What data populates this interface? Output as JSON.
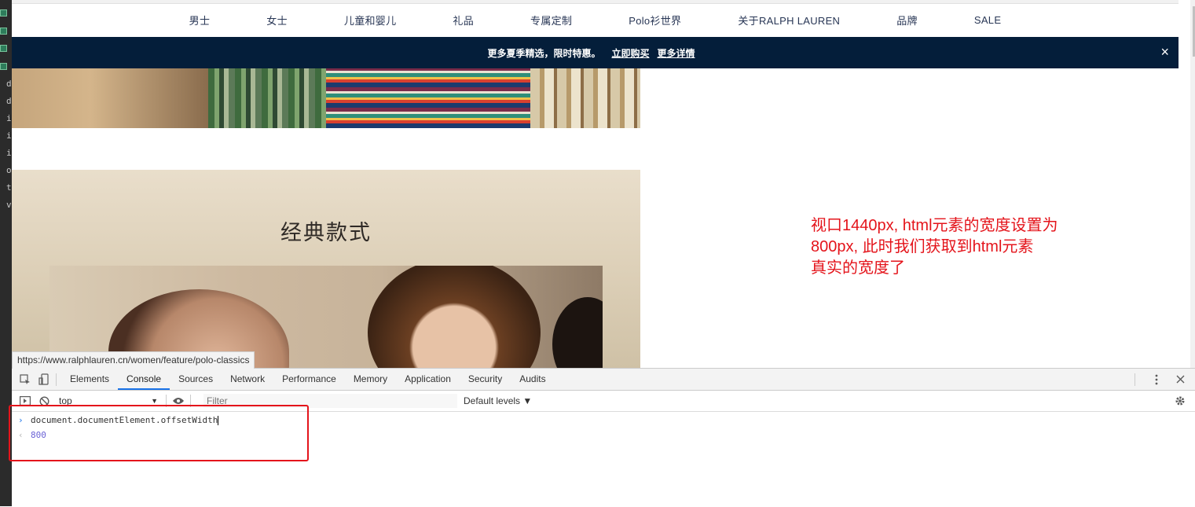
{
  "left_strip": {
    "tokens": [
      "d",
      "d",
      "ir",
      "ir",
      "ir",
      "o",
      "tc",
      "v"
    ]
  },
  "nav": {
    "items": [
      "男士",
      "女士",
      "儿童和婴儿",
      "礼品",
      "专属定制",
      "Polo衫世界",
      "关于RALPH LAUREN",
      "品牌",
      "SALE"
    ]
  },
  "promo": {
    "message": "更多夏季精选，限时特惠。",
    "link_shop": "立即购买",
    "link_more": "更多详情",
    "close": "×"
  },
  "classics": {
    "title": "经典款式"
  },
  "url_tooltip": "https://www.ralphlauren.cn/women/feature/polo-classics",
  "annotation": {
    "line1": "视口1440px, html元素的宽度设置为",
    "line2": "800px, 此时我们获取到html元素",
    "line3": "真实的宽度了"
  },
  "devtools": {
    "tabs": [
      "Elements",
      "Console",
      "Sources",
      "Network",
      "Performance",
      "Memory",
      "Application",
      "Security",
      "Audits"
    ],
    "active_tab": "Console",
    "context": "top",
    "filter_placeholder": "Filter",
    "levels": "Default levels ▼",
    "input_command": "document.documentElement.offsetWidth",
    "output_value": "800"
  },
  "colors": {
    "promo_bg": "#041e3a",
    "nav_text": "#283655",
    "annotation_red": "#e4141b",
    "console_result": "#6b62d6"
  }
}
